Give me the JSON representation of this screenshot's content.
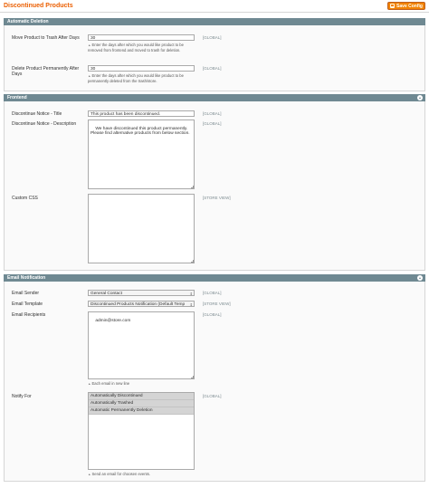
{
  "page": {
    "title": "Discontinued Products",
    "save_label": "Save Config"
  },
  "sections": {
    "automatic_deletion": {
      "title": "Automatic Deletion",
      "move_to_trash": {
        "label": "Move Product to Trash After Days",
        "value": "30",
        "note": "Enter the days after which you would like product to be removed from frontend and moved to trash for deletion.",
        "scope": "[GLOBAL]"
      },
      "delete_permanently": {
        "label": "Delete Product Permanently After Days",
        "value": "30",
        "note": "Enter the days after which you would like product to be permanently deleted from the trash/store.",
        "scope": "[GLOBAL]"
      }
    },
    "frontend": {
      "title": "Frontend",
      "notice_title": {
        "label": "Discontinue Notice - Title",
        "value": "This product has been discontinued.",
        "scope": "[GLOBAL]"
      },
      "notice_description": {
        "label": "Discontinue Notice - Description",
        "value": "We have discontinued this product permanently. Please find alternative products from below section.",
        "scope": "[GLOBAL]"
      },
      "custom_css": {
        "label": "Custom CSS",
        "value": "",
        "scope": "[STORE VIEW]"
      }
    },
    "email_notification": {
      "title": "Email Notification",
      "sender": {
        "label": "Email Sender",
        "value": "General Contact",
        "scope": "[GLOBAL]"
      },
      "template": {
        "label": "Email Template",
        "value": "Discontinued Products Notification (Default Temp",
        "scope": "[STORE VIEW]"
      },
      "recipients": {
        "label": "Email Recipients",
        "value": "admin@store.com",
        "note": "Each email in new line",
        "scope": "[GLOBAL]"
      },
      "notify_for": {
        "label": "Notify For",
        "options": [
          "Automatically Discontinued",
          "Automatically Trashed",
          "Automatic Permanently Deletion"
        ],
        "note": "Send an email for choosen events.",
        "scope": "[GLOBAL]"
      }
    }
  }
}
